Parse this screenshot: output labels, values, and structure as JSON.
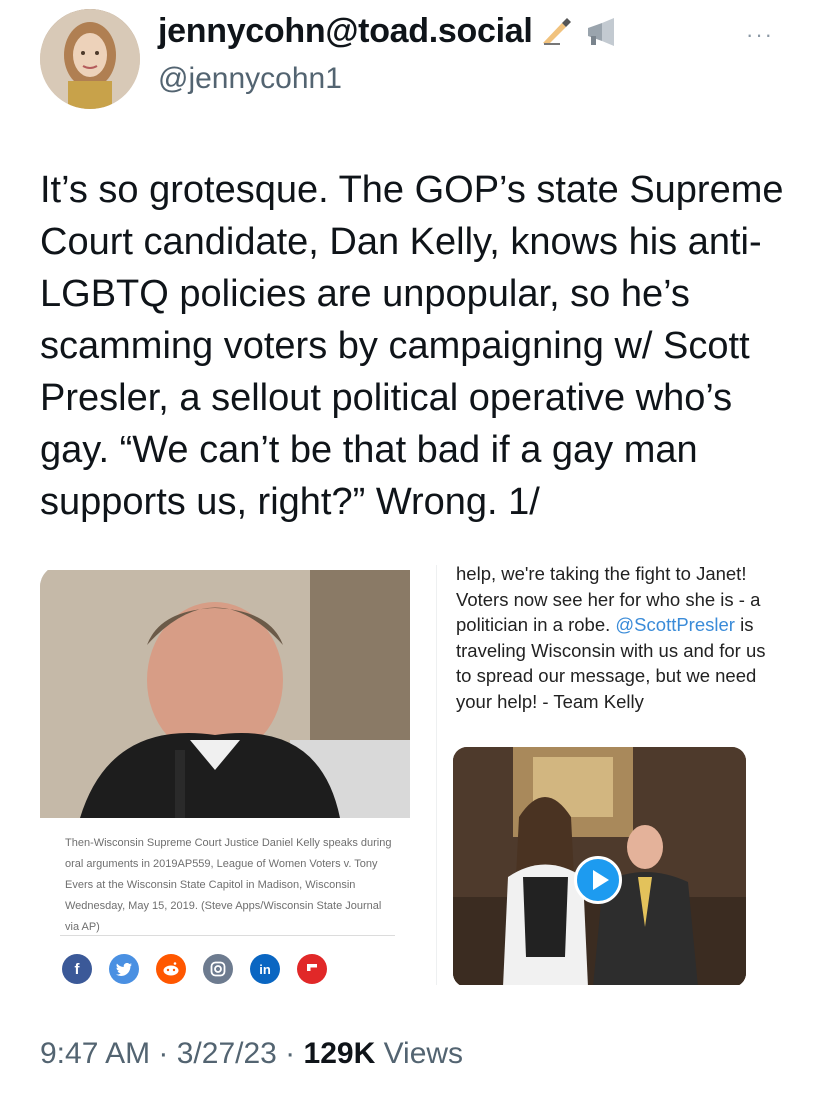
{
  "author": {
    "display_name": "jennycohn@toad.social",
    "handle": "@jennycohn1",
    "name_emojis": [
      "writing-hand-icon",
      "megaphone-icon"
    ]
  },
  "more_menu": "···",
  "tweet": {
    "text": "It’s so grotesque. The GOP’s state Supreme\nCourt candidate, Dan Kelly, knows his anti-\nLGBTQ policies are unpopular, so he’s\nscamming voters by campaigning w/ Scott\nPresler, a sellout political operative who’s\ngay. “We can’t be that bad if a gay man\nsupports us, right?” Wrong. 1/"
  },
  "media": {
    "article_caption": "Then-Wisconsin Supreme Court Justice Daniel Kelly speaks during oral arguments in 2019AP559, League of Women Voters v. Tony Evers at the Wisconsin State Capitol in Madison, Wisconsin Wednesday, May 15, 2019. (Steve Apps/Wisconsin State Journal via AP)",
    "share_icons": [
      {
        "name": "facebook-icon",
        "glyph": "f",
        "color": "#3b5998"
      },
      {
        "name": "twitter-icon",
        "glyph": "❧",
        "color": "#4a90e2"
      },
      {
        "name": "reddit-icon",
        "glyph": "☺",
        "color": "#ff5700"
      },
      {
        "name": "instagram-icon",
        "glyph": "◎",
        "color": "#6d7b8f"
      },
      {
        "name": "linkedin-icon",
        "glyph": "in",
        "color": "#0a66c2"
      },
      {
        "name": "flipboard-icon",
        "glyph": "F",
        "color": "#e12828"
      }
    ],
    "promo_text_before": "help, we're taking the fight to Janet! Voters now see her for who she is - a politician in a robe. ",
    "promo_mention": "@ScottPresler",
    "promo_text_after": " is traveling Wisconsin with us and for us to spread our message, but we need your help! - Team Kelly"
  },
  "meta": {
    "time": "9:47 AM",
    "sep1": " · ",
    "date": "3/27/23",
    "sep2": " · ",
    "views_count": "129K",
    "views_label": " Views"
  },
  "colors": {
    "link": "#1d9bf0",
    "secondary_text": "#536471",
    "primary_text": "#0f1419"
  }
}
